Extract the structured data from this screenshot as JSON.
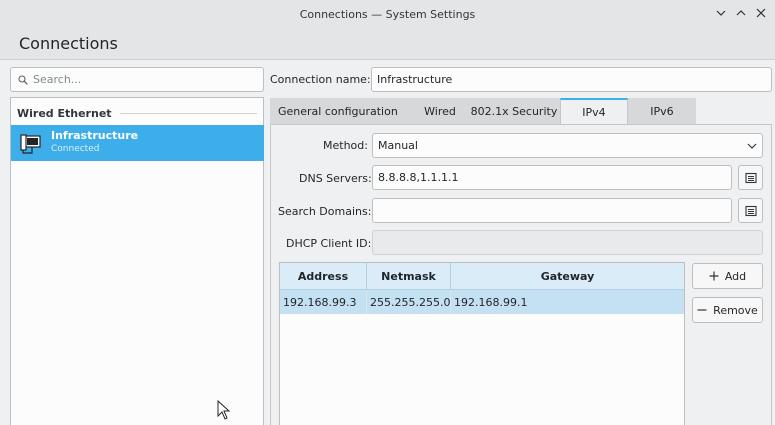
{
  "window": {
    "title": "Connections — System Settings"
  },
  "header": {
    "title": "Connections"
  },
  "search": {
    "placeholder": "Search..."
  },
  "connections": {
    "section": "Wired Ethernet",
    "items": [
      {
        "name": "Infrastructure",
        "state": "Connected"
      }
    ]
  },
  "form": {
    "name_label": "Connection name:",
    "name_value": "Infrastructure",
    "tabs": [
      "General configuration",
      "Wired",
      "802.1x Security",
      "IPv4",
      "IPv6"
    ],
    "active_tab": "IPv4",
    "method_label": "Method:",
    "method_value": "Manual",
    "dns_label": "DNS Servers:",
    "dns_value": "8.8.8.8,1.1.1.1",
    "search_domains_label": "Search Domains:",
    "search_domains_value": "",
    "dhcp_label": "DHCP Client ID:",
    "dhcp_value": ""
  },
  "addresses": {
    "columns": [
      "Address",
      "Netmask",
      "Gateway"
    ],
    "rows": [
      [
        "192.168.99.3",
        "255.255.255.0",
        "192.168.99.1"
      ]
    ],
    "add_label": "Add",
    "remove_label": "Remove"
  },
  "colors": {
    "accent": "#3daee9",
    "window_bg": "#eff0f1",
    "table_header": "#d9ecf8",
    "selected_row": "#c4e1f4"
  }
}
